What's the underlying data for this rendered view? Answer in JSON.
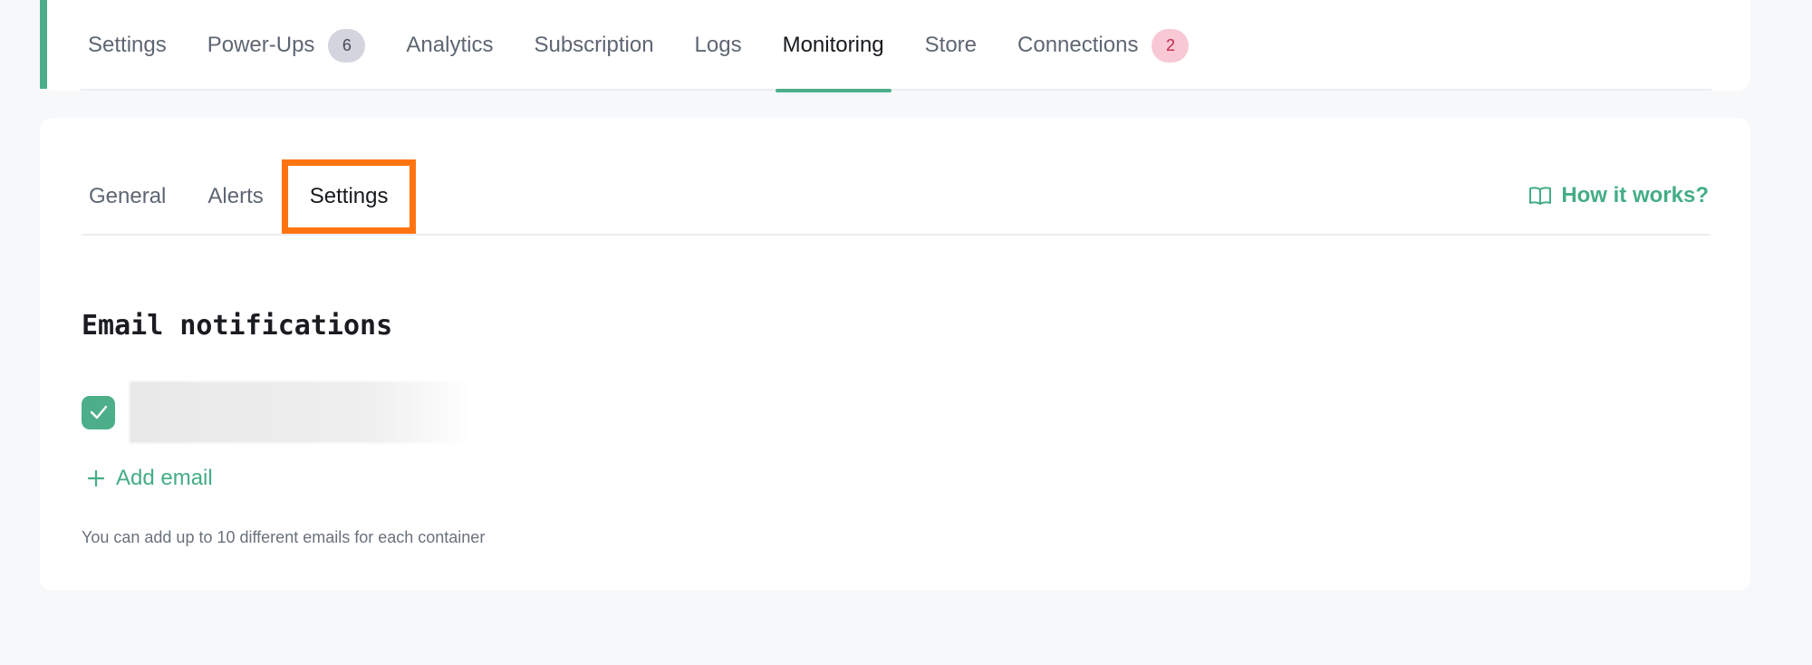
{
  "main_tabs": [
    {
      "label": "Settings"
    },
    {
      "label": "Power-Ups",
      "badge": "6"
    },
    {
      "label": "Analytics"
    },
    {
      "label": "Subscription"
    },
    {
      "label": "Logs"
    },
    {
      "label": "Monitoring",
      "active": true
    },
    {
      "label": "Store"
    },
    {
      "label": "Connections",
      "badge": "2"
    }
  ],
  "sub_tabs": [
    {
      "label": "General"
    },
    {
      "label": "Alerts"
    },
    {
      "label": "Settings",
      "active": true
    }
  ],
  "help_link": {
    "label": "How it works?",
    "icon": "book-icon"
  },
  "section": {
    "title": "Email notifications",
    "email_checked": true,
    "add_label": "Add email",
    "hint": "You can add up to 10 different emails for each container"
  },
  "colors": {
    "accent": "#4caf8a",
    "highlight": "#ff7410",
    "badge_grey": "#d3d4dd",
    "badge_pink": "#f8c8d4"
  }
}
